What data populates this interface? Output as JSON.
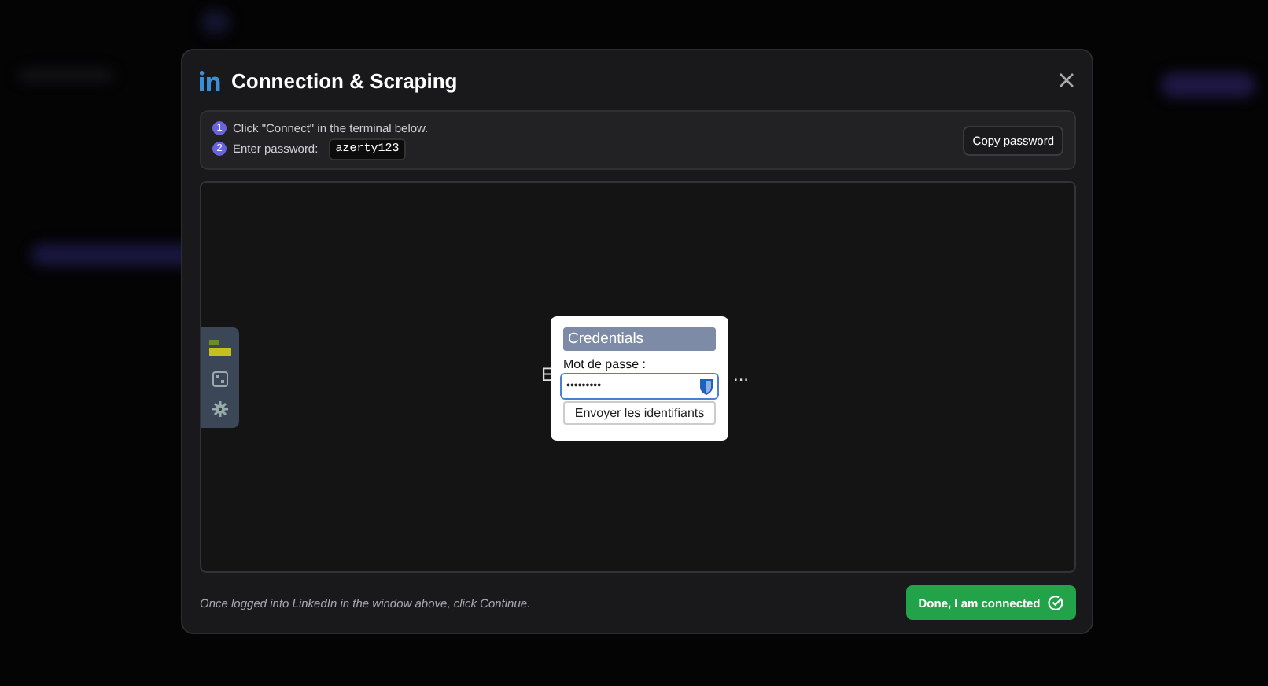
{
  "dialog": {
    "title": "Connection & Scraping",
    "steps": [
      {
        "number": "1",
        "text": "Click \"Connect\" in the terminal below."
      },
      {
        "number": "2",
        "text": "Enter password:",
        "code": "azerty123"
      }
    ],
    "copy_button": "Copy password",
    "vnc": {
      "status_left": "E",
      "status_right": "...",
      "panel": {
        "title": "Credentials",
        "label": "Mot de passe :",
        "value": "•••••••••",
        "submit": "Envoyer les identifiants"
      }
    },
    "footer_note": "Once logged into LinkedIn in the window above, click Continue.",
    "done_button": "Done, I am connected"
  }
}
